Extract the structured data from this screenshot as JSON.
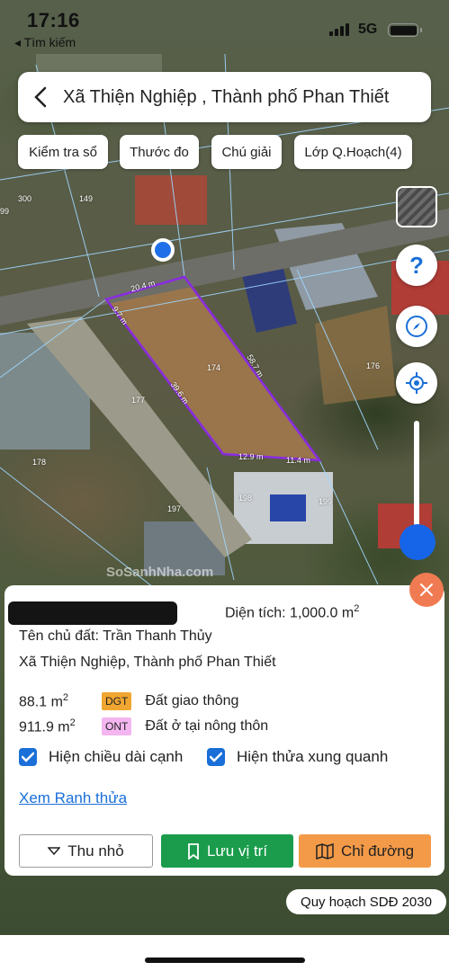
{
  "status_bar": {
    "time": "17:16",
    "back_label": "◂ Tìm kiếm",
    "network": "5G"
  },
  "header": {
    "title": "Xã Thiện Nghiệp , Thành phố Phan Thiết"
  },
  "chips": [
    "Kiểm tra sổ",
    "Thước đo",
    "Chú giải",
    "Lớp Q.Hoạch(4)"
  ],
  "map": {
    "parcel_numbers": [
      "300",
      "149",
      "99",
      "174",
      "176",
      "177",
      "178",
      "198",
      "199",
      "197"
    ],
    "edge_lengths": [
      "20.4 m",
      "9.7 m",
      "58.7 m",
      "39.6 m",
      "12.9 m",
      "11.4 m"
    ],
    "parcel_color": "#8a2be2",
    "watermark": "SoSanhNha.com"
  },
  "card": {
    "area_label": "Diện tích:",
    "area_value": "1,000.0 m",
    "area_unit_sup": "2",
    "owner": "Tên chủ đất: Trần Thanh Thủy",
    "address": "Xã Thiện Nghiệp, Thành phố Phan Thiết",
    "land_uses": [
      {
        "amount": "88.1 m",
        "sup": "2",
        "code": "DGT",
        "code_color": "#f0a630",
        "description": "Đất giao thông"
      },
      {
        "amount": "911.9 m",
        "sup": "2",
        "code": "ONT",
        "code_color": "#f4b6f0",
        "description": "Đất ở tại nông thôn"
      }
    ],
    "checkbox_edge_lengths": "Hiện chiều dài cạnh",
    "checkbox_neighbors": "Hiện thửa xung quanh",
    "link_boundary": "Xem Ranh thửa",
    "btn_minimize": "Thu nhỏ",
    "btn_save": "Lưu vị trí",
    "btn_directions": "Chỉ đường"
  },
  "plan_badge": "Quy hoạch SDĐ 2030",
  "colors": {
    "accent": "#1665e8",
    "save_green": "#1b9c4c",
    "directions_orange": "#f39a48",
    "close_orange": "#f07b52"
  },
  "icons": [
    "chevron-left-icon",
    "layers-icon",
    "help-icon",
    "compass-icon",
    "locate-icon",
    "close-icon",
    "chevron-down-icon",
    "bookmark-icon",
    "map-icon",
    "check-icon"
  ]
}
